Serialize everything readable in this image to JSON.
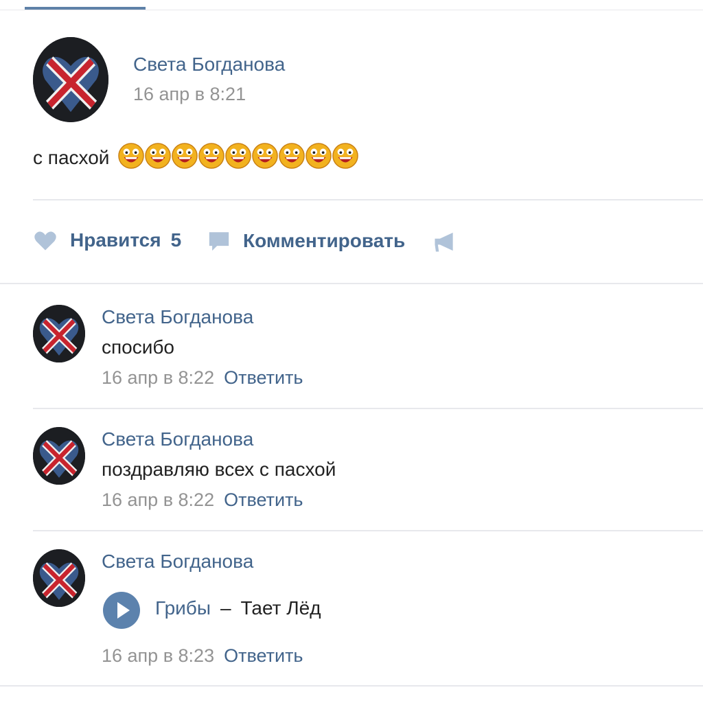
{
  "post": {
    "author": "Света Богданова",
    "time": "16 апр в 8:21",
    "text": "с пасхой",
    "emoji_name": "laughing-emoji",
    "emoji_count": 9
  },
  "actions": {
    "like_label": "Нравится",
    "like_count": "5",
    "comment_label": "Комментировать"
  },
  "comments": [
    {
      "author": "Света Богданова",
      "text": "спосибо",
      "time": "16 апр в 8:22",
      "reply_label": "Ответить"
    },
    {
      "author": "Света Богданова",
      "text": "поздравляю всех с пасхой",
      "time": "16 апр в 8:22",
      "reply_label": "Ответить"
    },
    {
      "author": "Света Богданова",
      "audio": {
        "artist": "Грибы",
        "separator": "–",
        "title": "Тает Лёд"
      },
      "time": "16 апр в 8:23",
      "reply_label": "Ответить"
    }
  ],
  "colors": {
    "link": "#42648b",
    "muted": "#939393",
    "icon": "#b0c3d9",
    "play": "#5c82ad"
  }
}
